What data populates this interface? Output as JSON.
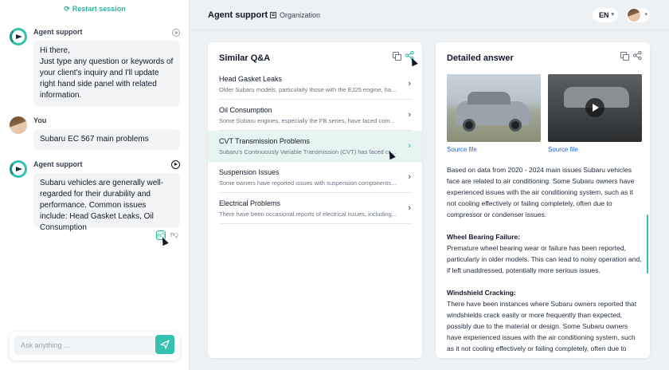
{
  "chat": {
    "restart_label": "Restart session",
    "messages": [
      {
        "sender": "Agent support",
        "text": "Hi there,\nJust type any question or keywords of your client's inquiry and I'll update right hand side panel with related information."
      },
      {
        "sender": "You",
        "text": "Subaru EC 567 main problems"
      },
      {
        "sender": "Agent support",
        "text": "Subaru vehicles are generally well-regarded for their durability and performance. Common issues include: Head Gasket Leaks, Oil Consumption"
      }
    ],
    "input_placeholder": "Ask anything ..."
  },
  "header": {
    "title": "Agent support",
    "organization_label": "Organization",
    "language": "EN"
  },
  "qa": {
    "title": "Similar Q&A",
    "items": [
      {
        "title": "Head Gasket Leaks",
        "desc": "Older Subaru models, particularly those with the EJ25 engine, ha..."
      },
      {
        "title": "Oil Consumption",
        "desc": "Some Subaru engines, especially the FB series, have faced compl..."
      },
      {
        "title": "CVT Transmission Problems",
        "desc": "Subaru's Continuously Variable Transmission (CVT) has faced criti..."
      },
      {
        "title": "Suspension Issues",
        "desc": "Some owners have reported issues with suspension components,..."
      },
      {
        "title": "Electrical Problems",
        "desc": "There have been occasional reports of electrical issues, including..."
      }
    ]
  },
  "detail": {
    "title": "Detailed answer",
    "source_label_1": "Source file",
    "source_label_2": "Source file",
    "intro": "Based on data from 2020 - 2024 main issues Subaru vehicles face are related to air conditioning. Some Subaru owners have experienced issues with the air conditioning system, such as it not cooling effectively or failing completely, often due to compressor or condenser issues.",
    "section1_title": "Wheel Bearing Failure:",
    "section1_text": "Premature wheel bearing wear or failure has been reported, particularly in older models. This can lead to noisy operation and, if left unaddressed, potentially more serious issues.",
    "section2_title": "Windshield Cracking:",
    "section2_text": "There have been instances where Subaru owners reported that windshields crack easily or more frequently than expected, possibly due to the material or design. Some Subaru owners have experienced issues with the air conditioning system, such as it not cooling effectively or failing completely, often due to compressor"
  },
  "colors": {
    "accent": "#34c2ae",
    "link": "#2563eb",
    "selected_row": "#e6f5f1"
  },
  "icons": [
    "restart-icon",
    "play-icon",
    "thumbs-up-icon",
    "thumbs-down-icon",
    "send-icon",
    "building-icon",
    "chevron-down-icon",
    "copy-icon",
    "share-icon",
    "chevron-right-icon"
  ]
}
